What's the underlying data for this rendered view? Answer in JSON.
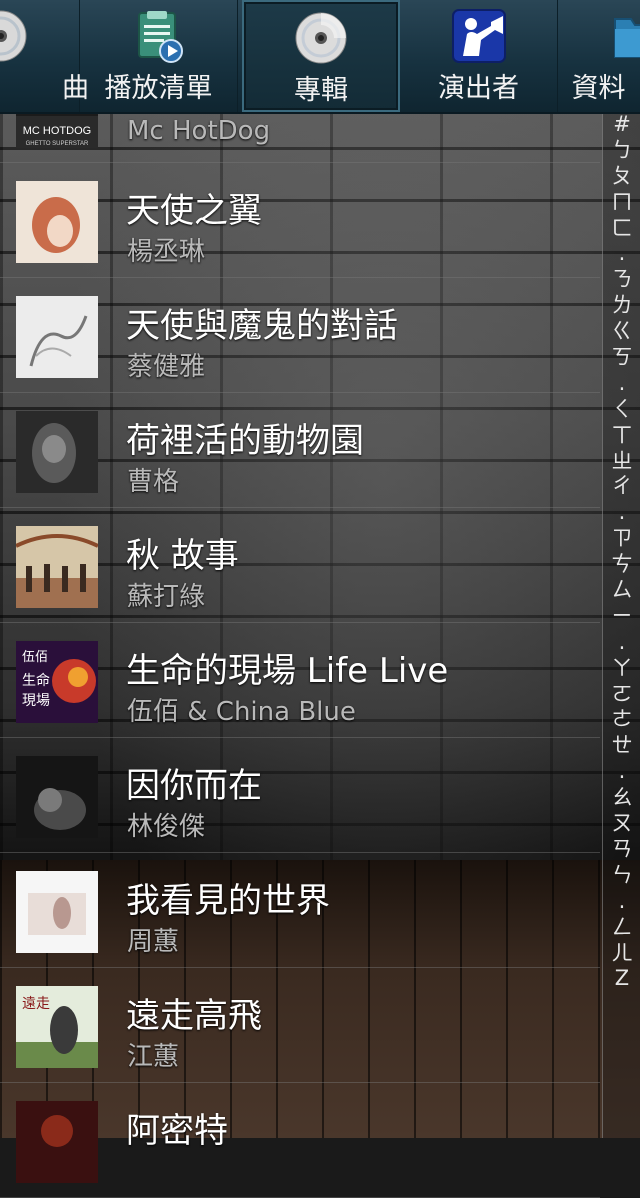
{
  "tabs": [
    {
      "label": "曲",
      "icon": "cd-icon"
    },
    {
      "label": "播放清單",
      "icon": "playlist-icon"
    },
    {
      "label": "專輯",
      "icon": "cd-icon",
      "active": true
    },
    {
      "label": "演出者",
      "icon": "trumpet-player-icon"
    },
    {
      "label": "資料",
      "icon": "folder-icon"
    }
  ],
  "albums": [
    {
      "title": "",
      "artist": "Mc HotDog",
      "cover_text": "MC HOTDOG",
      "cover_sub": "GHETTO SUPERSTAR",
      "cover_colors": [
        "#1b1b1b",
        "#3a3a3a"
      ]
    },
    {
      "title": "天使之翼",
      "artist": "楊丞琳",
      "cover_colors": [
        "#e9d6c8",
        "#c96c4a"
      ]
    },
    {
      "title": "天使與魔鬼的對話",
      "artist": "蔡健雅",
      "cover_colors": [
        "#e8e8e8",
        "#9a9a9a"
      ]
    },
    {
      "title": "荷裡活的動物園",
      "artist": "曹格",
      "cover_colors": [
        "#2a2a2a",
        "#6a6a6a"
      ]
    },
    {
      "title": "秋 故事",
      "artist": "蘇打綠",
      "cover_colors": [
        "#d6c6a8",
        "#8a4a2a"
      ]
    },
    {
      "title": "生命的現場 Life Live",
      "artist": "伍佰 & China Blue",
      "cover_text": "伍佰\n生命\n現場",
      "cover_colors": [
        "#2a0f3a",
        "#c83a2a"
      ]
    },
    {
      "title": "因你而在",
      "artist": "林俊傑",
      "cover_colors": [
        "#151515",
        "#4a4a4a"
      ]
    },
    {
      "title": "我看見的世界",
      "artist": "周蕙",
      "cover_colors": [
        "#f4f4f4",
        "#c8b8b0"
      ]
    },
    {
      "title": "遠走高飛",
      "artist": "江蕙",
      "cover_colors": [
        "#dfe6d8",
        "#4a6a3a"
      ]
    },
    {
      "title": "阿密特",
      "artist": "",
      "cover_colors": [
        "#3a1010",
        "#8a2a1a"
      ]
    }
  ],
  "index_letters": [
    "#",
    "ㄅ",
    "ㄆ",
    "ㄇ",
    "ㄈ",
    ".",
    "ㄋ",
    "ㄌ",
    "ㄍ",
    "ㄎ",
    ".",
    "ㄑ",
    "ㄒ",
    "ㄓ",
    "ㄔ",
    ".",
    "ㄗ",
    "ㄘ",
    "ㄙ",
    "ㄧ",
    ".",
    "ㄚ",
    "ㄛ",
    "ㄜ",
    "ㄝ",
    ".",
    "ㄠ",
    "ㄡ",
    "ㄢ",
    "ㄣ",
    ".",
    "ㄥ",
    "ㄦ",
    "Z"
  ],
  "colors": {
    "tab_bg": "#173240",
    "active_border": "#3b6a7e",
    "artist_text": "#b9b9b9"
  }
}
